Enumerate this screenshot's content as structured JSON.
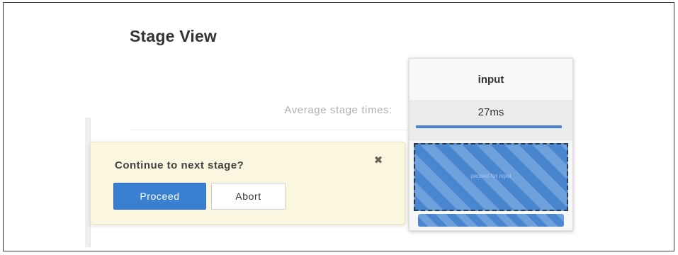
{
  "page": {
    "title": "Stage View",
    "average_label": "Average stage times:"
  },
  "stage": {
    "name": "input",
    "average_time": "27ms",
    "cell_text": "paused for input"
  },
  "prompt": {
    "message": "Continue to next stage?",
    "close_glyph": "✖",
    "proceed_label": "Proceed",
    "abort_label": "Abort"
  },
  "colors": {
    "accent": "#3a7fd0",
    "popup_bg": "#fbf6df",
    "stage_stripe": "#4a86d0"
  }
}
